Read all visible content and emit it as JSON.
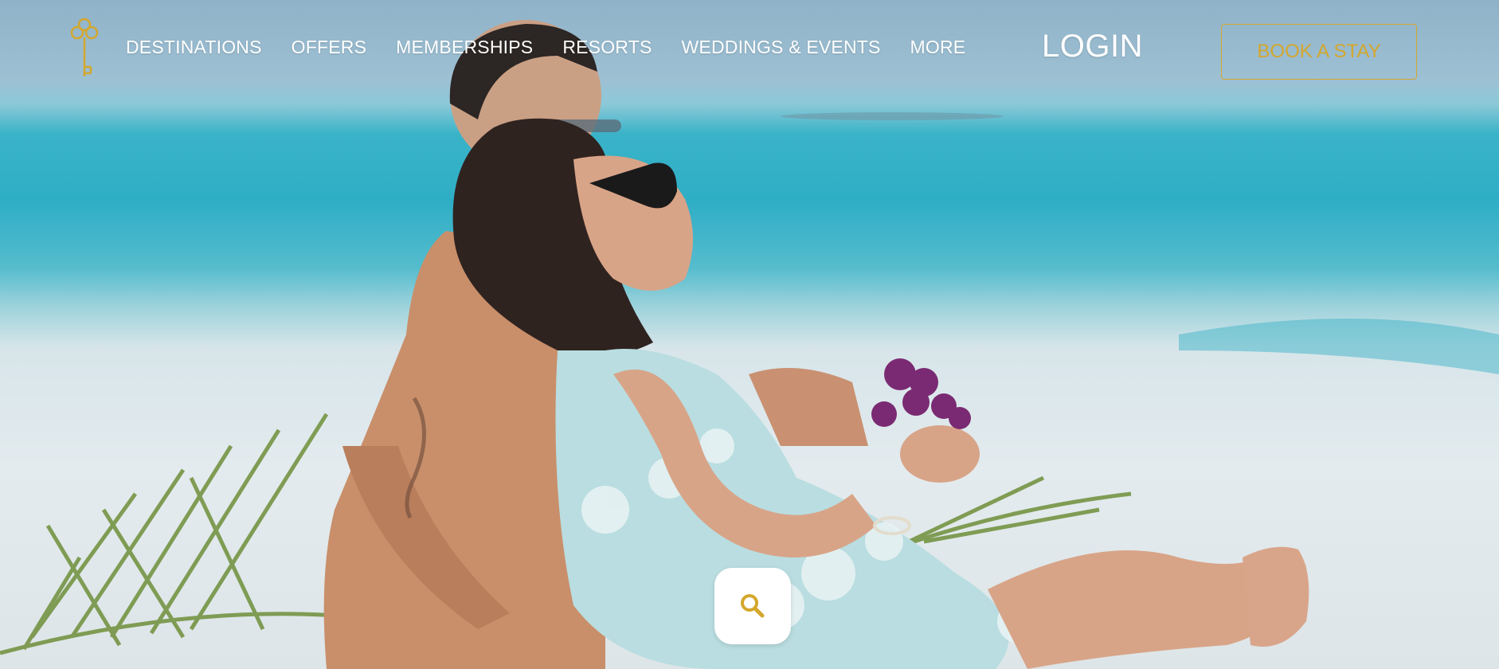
{
  "brand": {
    "logo_icon": "golden-key-icon",
    "accent_color": "#d4a72c"
  },
  "nav": {
    "links": [
      {
        "label": "DESTINATIONS"
      },
      {
        "label": "OFFERS"
      },
      {
        "label": "MEMBERSHIPS"
      },
      {
        "label": "RESORTS"
      },
      {
        "label": "WEDDINGS & EVENTS"
      },
      {
        "label": "MORE"
      }
    ],
    "login_label": "LOGIN",
    "book_label": "BOOK A STAY"
  },
  "hero": {
    "image_icon": "beach-couple-photo"
  },
  "search": {
    "icon": "search-icon"
  }
}
